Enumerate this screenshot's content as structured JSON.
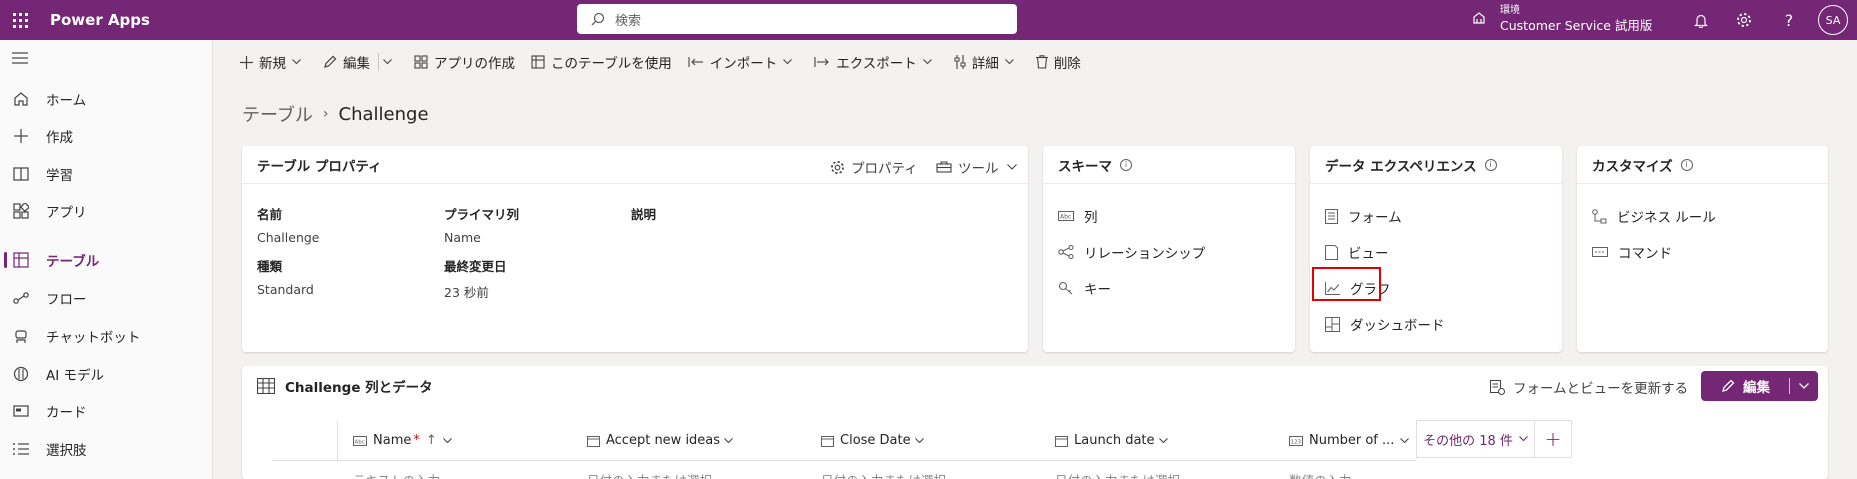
{
  "topbar": {
    "app_name": "Power Apps",
    "search_placeholder": "検索",
    "env_label": "環境",
    "env_name": "Customer Service 試用版",
    "avatar": "SA"
  },
  "nav": {
    "items": [
      {
        "label": "ホーム",
        "icon": "home-icon"
      },
      {
        "label": "作成",
        "icon": "plus-icon"
      },
      {
        "label": "学習",
        "icon": "book-icon"
      },
      {
        "label": "アプリ",
        "icon": "apps-icon"
      },
      {
        "label": "テーブル",
        "icon": "table-icon",
        "active": true
      },
      {
        "label": "フロー",
        "icon": "flow-icon"
      },
      {
        "label": "チャットボット",
        "icon": "bot-icon"
      },
      {
        "label": "AI モデル",
        "icon": "ai-icon"
      },
      {
        "label": "カード",
        "icon": "card-icon"
      },
      {
        "label": "選択肢",
        "icon": "list-icon"
      }
    ]
  },
  "cmdbar": {
    "new": "新規",
    "edit": "編集",
    "create_app": "アプリの作成",
    "use_table": "このテーブルを使用",
    "import": "インポート",
    "export": "エクスポート",
    "details": "詳細",
    "delete": "削除"
  },
  "breadcrumb": {
    "parent": "テーブル",
    "current": "Challenge"
  },
  "props_card": {
    "title": "テーブル プロパティ",
    "properties_btn": "プロパティ",
    "tools_btn": "ツール",
    "name_label": "名前",
    "name_value": "Challenge",
    "primary_label": "プライマリ列",
    "primary_value": "Name",
    "desc_label": "説明",
    "type_label": "種類",
    "type_value": "Standard",
    "modified_label": "最終変更日",
    "modified_value": "23 秒前"
  },
  "schema_card": {
    "title": "スキーマ",
    "links": [
      "列",
      "リレーションシップ",
      "キー"
    ]
  },
  "data_exp_card": {
    "title": "データ エクスペリエンス",
    "links": [
      "フォーム",
      "ビュー",
      "グラフ",
      "ダッシュボード"
    ]
  },
  "customize_card": {
    "title": "カスタマイズ",
    "links": [
      "ビジネス ルール",
      "コマンド"
    ]
  },
  "grid": {
    "title": "Challenge 列とデータ",
    "refresh": "フォームとビューを更新する",
    "edit": "編集",
    "columns": [
      "Name",
      "Accept new ideas",
      "Close Date",
      "Launch date",
      "Number of ..."
    ],
    "more_columns": "その他の 18 件",
    "placeholders": [
      "テキストの入力",
      "日付の入力または選択",
      "日付の入力または選択",
      "日付の入力または選択",
      "数値の入力"
    ]
  },
  "colors": {
    "brand": "#742774",
    "highlight": "#e50000"
  }
}
